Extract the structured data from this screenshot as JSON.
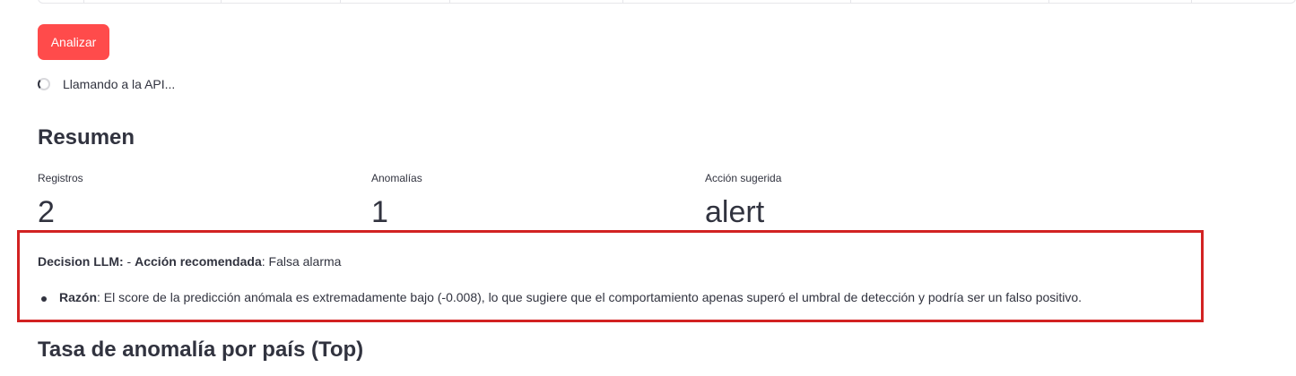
{
  "run_button_label": "Analizar",
  "status_text": "Llamando a la API...",
  "summary": {
    "title": "Resumen",
    "metrics": [
      {
        "label": "Registros",
        "value": "2"
      },
      {
        "label": "Anomalías",
        "value": "1"
      },
      {
        "label": "Acción sugerida",
        "value": "alert"
      }
    ]
  },
  "llm": {
    "prefix": "Decision LLM:",
    "action_sep": " - ",
    "action_label": "Acción recomendada",
    "action_value": ": Falsa alarma",
    "reason_label": "Razón",
    "reason_text": ": El score de la predicción anómala es extremadamente bajo (-0.008), lo que sugiere que el comportamiento apenas superó el umbral de detección y podría ser un falso positivo."
  },
  "section2_title": "Tasa de anomalía por país (Top)",
  "colors": {
    "primary": "#ff4b4b",
    "text": "#31333f",
    "highlight_border": "#d22222"
  }
}
